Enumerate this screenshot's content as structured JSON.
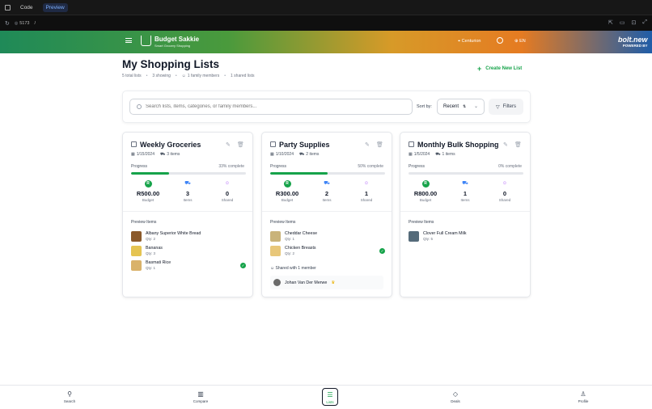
{
  "devtools": {
    "tab_code": "Code",
    "tab_preview": "Preview",
    "port": "5173",
    "path": "/"
  },
  "header": {
    "brand_name": "Budget Sakkie",
    "brand_sub": "Smart Grocery Shopping",
    "location": "Centurion",
    "language": "EN",
    "bolt_logo": "bolt.new",
    "bolt_sub": "POWERED BY"
  },
  "page": {
    "title": "My Shopping Lists",
    "stats": {
      "total": "5 total lists",
      "showing": "3 showing",
      "members": "1 family members",
      "shared": "1 shared lists"
    },
    "new_list_button": "Create New List"
  },
  "filters": {
    "search_placeholder": "Search lists, items, categories, or family members...",
    "sort_label": "Sort by:",
    "sort_value": "Recent",
    "filters_button": "Filters"
  },
  "card_labels": {
    "progress": "Progress",
    "budget": "Budget",
    "items": "Items",
    "shared": "Shared",
    "preview": "Preview Items"
  },
  "lists": [
    {
      "title": "Weekly Groceries",
      "date": "1/15/2024",
      "item_count": "3 items",
      "progress_text": "33% complete",
      "progress": 0.33,
      "budget": "R500.00",
      "items": "3",
      "shared": "0",
      "preview": [
        {
          "name": "Albany Superior White Bread",
          "qty": "Qty: 2",
          "done": false
        },
        {
          "name": "Bananas",
          "qty": "Qty: 3",
          "done": false
        },
        {
          "name": "Basmati Rice",
          "qty": "Qty: 1",
          "done": true
        }
      ]
    },
    {
      "title": "Party Supplies",
      "date": "1/10/2024",
      "item_count": "2 items",
      "progress_text": "50% complete",
      "progress": 0.5,
      "budget": "R300.00",
      "items": "2",
      "shared": "1",
      "preview": [
        {
          "name": "Cheddar Cheese",
          "qty": "Qty: 1",
          "done": false
        },
        {
          "name": "Chicken Breasts",
          "qty": "Qty: 2",
          "done": true
        }
      ],
      "shared_with": "Shared with 1 member",
      "member": "Johan Van Der Merwe"
    },
    {
      "title": "Monthly Bulk Shopping",
      "date": "1/5/2024",
      "item_count": "1 items",
      "progress_text": "0% complete",
      "progress": 0,
      "budget": "R800.00",
      "items": "1",
      "shared": "0",
      "preview": [
        {
          "name": "Clover Full Cream Milk",
          "qty": "Qty: 5",
          "done": false
        }
      ]
    }
  ],
  "nav": {
    "search": "Search",
    "compare": "Compare",
    "lists": "Lists",
    "deals": "Deals",
    "profile": "Profile"
  },
  "colors": {
    "accent": "#16a34a",
    "text": "#111827",
    "muted": "#6b7280"
  }
}
